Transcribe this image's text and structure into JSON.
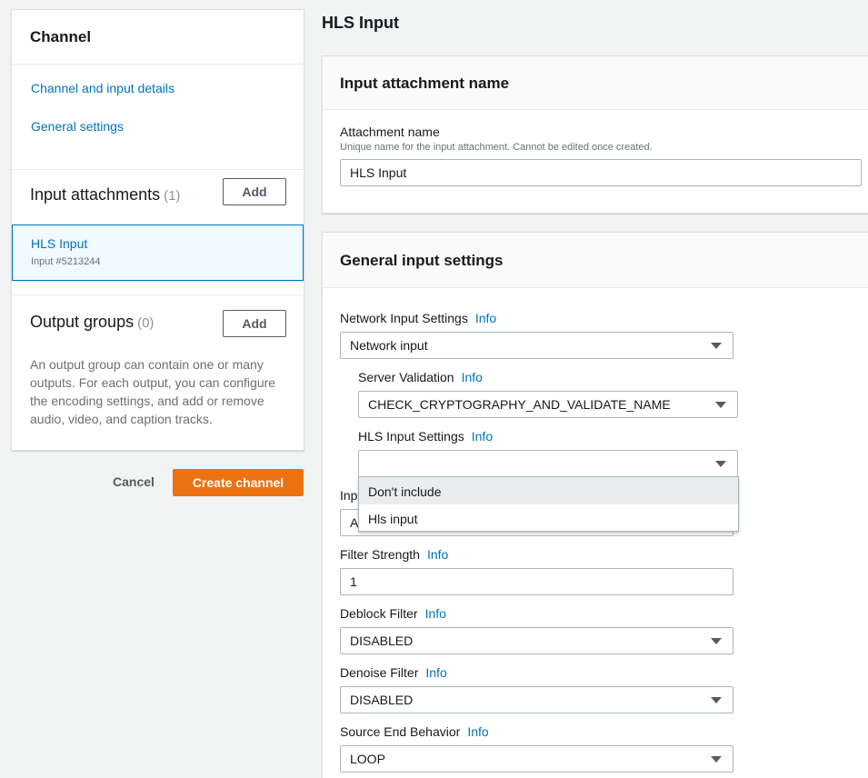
{
  "sidebar": {
    "title": "Channel",
    "links": [
      "Channel and input details",
      "General settings"
    ],
    "input_attachments": {
      "label": "Input attachments",
      "count": "(1)",
      "add_label": "Add"
    },
    "attachment": {
      "name": "HLS Input",
      "sub": "Input #5213244"
    },
    "output_groups": {
      "label": "Output groups",
      "count": "(0)",
      "add_label": "Add",
      "description": "An output group can contain one or many outputs. For each output, you can configure the encoding settings, and add or remove audio, video, and caption tracks."
    }
  },
  "actions": {
    "cancel": "Cancel",
    "create": "Create channel"
  },
  "main": {
    "title": "HLS Input",
    "attachment_panel": {
      "heading": "Input attachment name",
      "field_label": "Attachment name",
      "hint": "Unique name for the input attachment. Cannot be edited once created.",
      "value": "HLS Input"
    },
    "general_panel": {
      "heading": "General input settings",
      "info": "Info",
      "network_label": "Network Input Settings",
      "network_value": "Network input",
      "server_label": "Server Validation",
      "server_value": "CHECK_CRYPTOGRAPHY_AND_VALIDATE_NAME",
      "hls_label": "HLS Input Settings",
      "hls_value": "",
      "hidden_label_fragment": "Inp",
      "hidden_value_fragment": "A",
      "dropdown_options": [
        "Don't include",
        "Hls input"
      ],
      "filter_label": "Filter Strength",
      "filter_value": "1",
      "deblock_label": "Deblock Filter",
      "deblock_value": "DISABLED",
      "denoise_label": "Denoise Filter",
      "denoise_value": "DISABLED",
      "source_end_label": "Source End Behavior",
      "source_end_value": "LOOP"
    }
  }
}
